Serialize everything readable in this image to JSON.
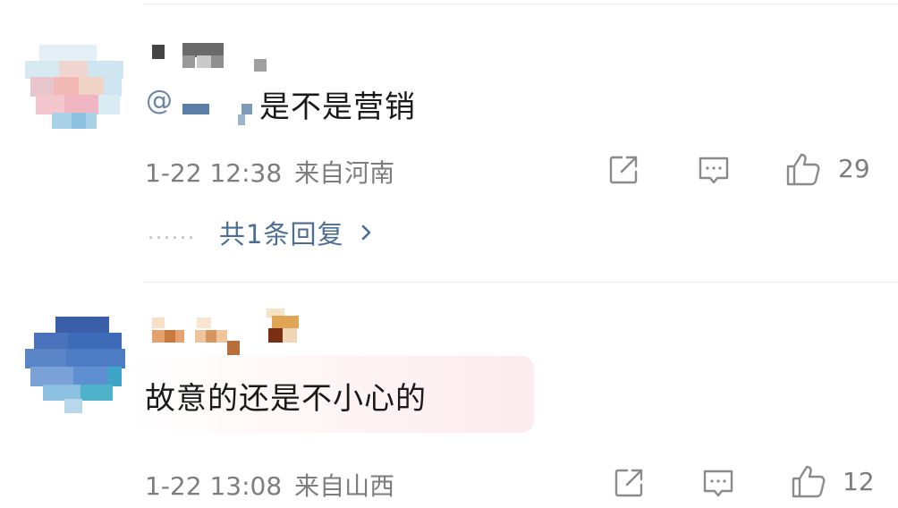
{
  "comments": [
    {
      "mention_symbol": "@",
      "text": "是不是营销",
      "time": "1-22 12:38",
      "location": "来自河南",
      "likes": "29",
      "reply_summary": "共1条回复",
      "reply_dots": "......",
      "icons": [
        "share-icon",
        "comment-icon",
        "thumbs-up-icon",
        "chevron-right-icon"
      ]
    },
    {
      "text": "故意的还是不小心的",
      "time": "1-22 13:08",
      "location": "来自山西",
      "likes": "12",
      "icons": [
        "share-icon",
        "comment-icon",
        "thumbs-up-icon"
      ]
    }
  ],
  "colors": {
    "meta_gray": "#7d7d7d",
    "link_blue": "#4c6d94",
    "mention_blue": "#6b86a6",
    "bubble_pink": "#fcebef"
  }
}
